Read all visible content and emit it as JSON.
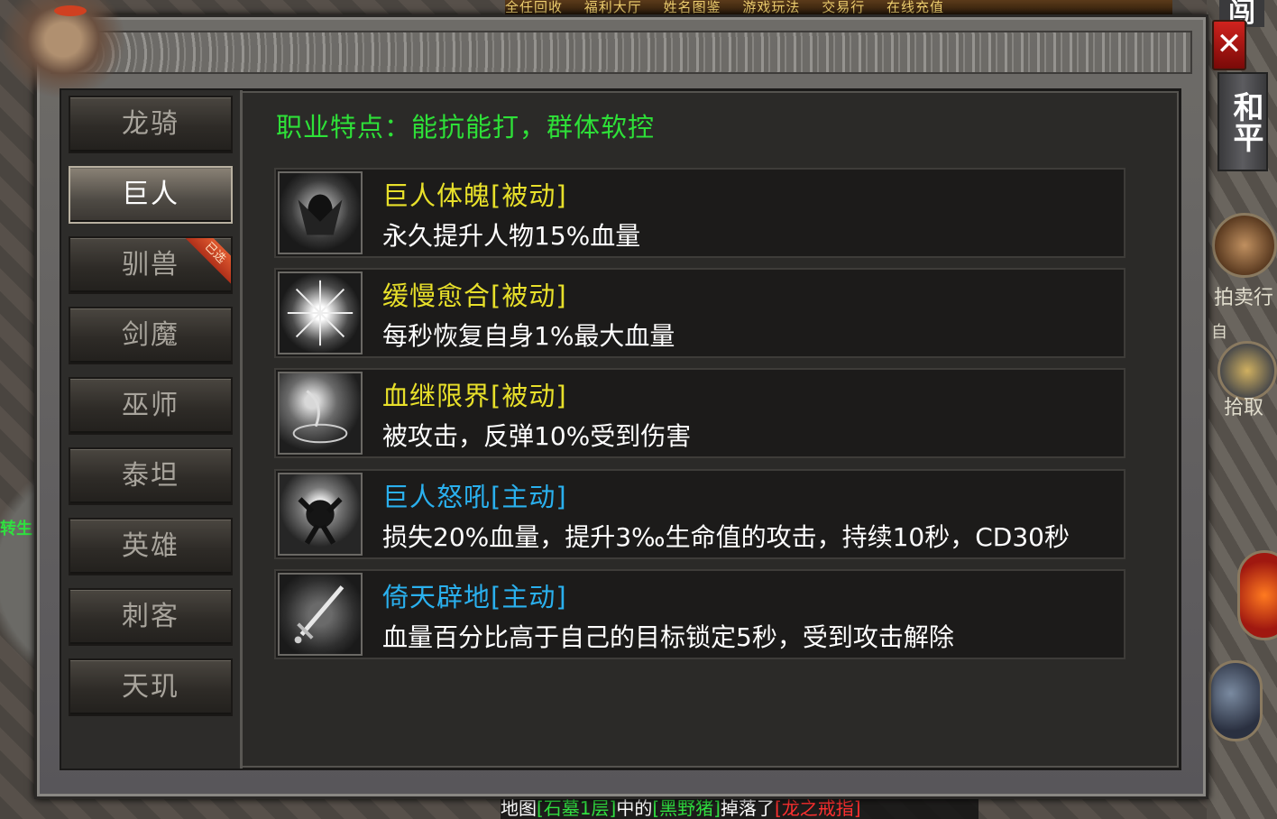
{
  "top_menu": [
    "全任回收",
    "福利大厅",
    "姓名图鉴",
    "游戏玩法",
    "交易行",
    "在线充值"
  ],
  "right_panel": {
    "close_symbol": "✕",
    "top_char": "闯",
    "peace_label": "和平",
    "auction_label": "拍卖行",
    "auto_label": "自",
    "pickup_label": "拾取"
  },
  "left_edge_text": "转生",
  "chat_line": {
    "prefix": "地图",
    "map": "[石墓1层]",
    "mid": "中的",
    "monster": "[黑野猪]",
    "dropped": "掉落了",
    "item": "[龙之戒指]"
  },
  "tabs": [
    {
      "label": "龙骑",
      "active": false
    },
    {
      "label": "巨人",
      "active": true
    },
    {
      "label": "驯兽",
      "active": false,
      "ribbon": "已选"
    },
    {
      "label": "剑魔",
      "active": false
    },
    {
      "label": "巫师",
      "active": false
    },
    {
      "label": "泰坦",
      "active": false
    },
    {
      "label": "英雄",
      "active": false
    },
    {
      "label": "刺客",
      "active": false
    },
    {
      "label": "天玑",
      "active": false
    }
  ],
  "feature_text": "职业特点：能抗能打，群体软控",
  "skills": [
    {
      "name": "巨人体魄[被动]",
      "type": "passive",
      "desc": "永久提升人物15%血量",
      "icon": "giant-body-icon"
    },
    {
      "name": "缓慢愈合[被动]",
      "type": "passive",
      "desc": "每秒恢复自身1%最大血量",
      "icon": "slow-heal-icon"
    },
    {
      "name": "血继限界[被动]",
      "type": "passive",
      "desc": "被攻击，反弹10%受到伤害",
      "icon": "blood-limit-icon"
    },
    {
      "name": "巨人怒吼[主动]",
      "type": "active",
      "desc": "损失20%血量，提升3‰生命值的攻击，持续10秒，CD30秒",
      "icon": "giant-roar-icon"
    },
    {
      "name": "倚天辟地[主动]",
      "type": "active",
      "desc": "血量百分比高于自己的目标锁定5秒，受到攻击解除",
      "icon": "sword-strike-icon"
    }
  ],
  "colors": {
    "feature": "#2ee038",
    "passive": "#e8e02a",
    "active": "#2ab0ee",
    "close": "#d0231e"
  }
}
